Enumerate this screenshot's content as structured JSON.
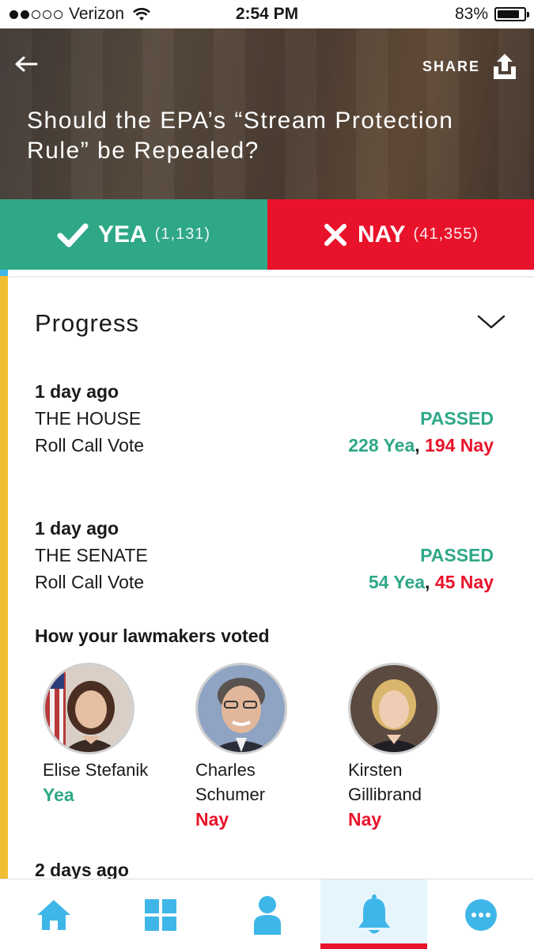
{
  "status_bar": {
    "carrier": "Verizon",
    "time": "2:54 PM",
    "battery": "83%",
    "battery_level": 0.83
  },
  "header": {
    "title": "Should the EPA’s “Stream Protection Rule” be Repealed?",
    "share_label": "SHARE"
  },
  "vote": {
    "yea_label": "YEA",
    "yea_count": "(1,131)",
    "nay_label": "NAY",
    "nay_count": "(41,355)"
  },
  "progress": {
    "title": "Progress",
    "events": [
      {
        "time": "1 day ago",
        "chamber": "THE HOUSE",
        "status": "PASSED",
        "vote_type": "Roll Call Vote",
        "yea": "228 Yea",
        "nay": "194 Nay"
      },
      {
        "time": "1 day ago",
        "chamber": "THE SENATE",
        "status": "PASSED",
        "vote_type": "Roll Call Vote",
        "yea": "54 Yea",
        "nay": "45 Nay"
      }
    ],
    "lawmakers_title": "How your lawmakers voted",
    "lawmakers": [
      {
        "name": "Elise Stefanik",
        "vote": "Yea"
      },
      {
        "name_line1": "Charles",
        "name_line2": "Schumer",
        "vote": "Nay"
      },
      {
        "name_line1": "Kirsten",
        "name_line2": "Gillibrand",
        "vote": "Nay"
      }
    ],
    "next_event_time": "2 days ago"
  },
  "tabs": [
    {
      "icon": "home-icon"
    },
    {
      "icon": "grid-icon"
    },
    {
      "icon": "person-icon"
    },
    {
      "icon": "bell-icon",
      "active": true
    },
    {
      "icon": "more-icon"
    }
  ],
  "colors": {
    "yea": "#2fa888",
    "nay": "#e8132a",
    "accent_blue": "#3fb6e8",
    "accent_yellow": "#f0be30"
  }
}
